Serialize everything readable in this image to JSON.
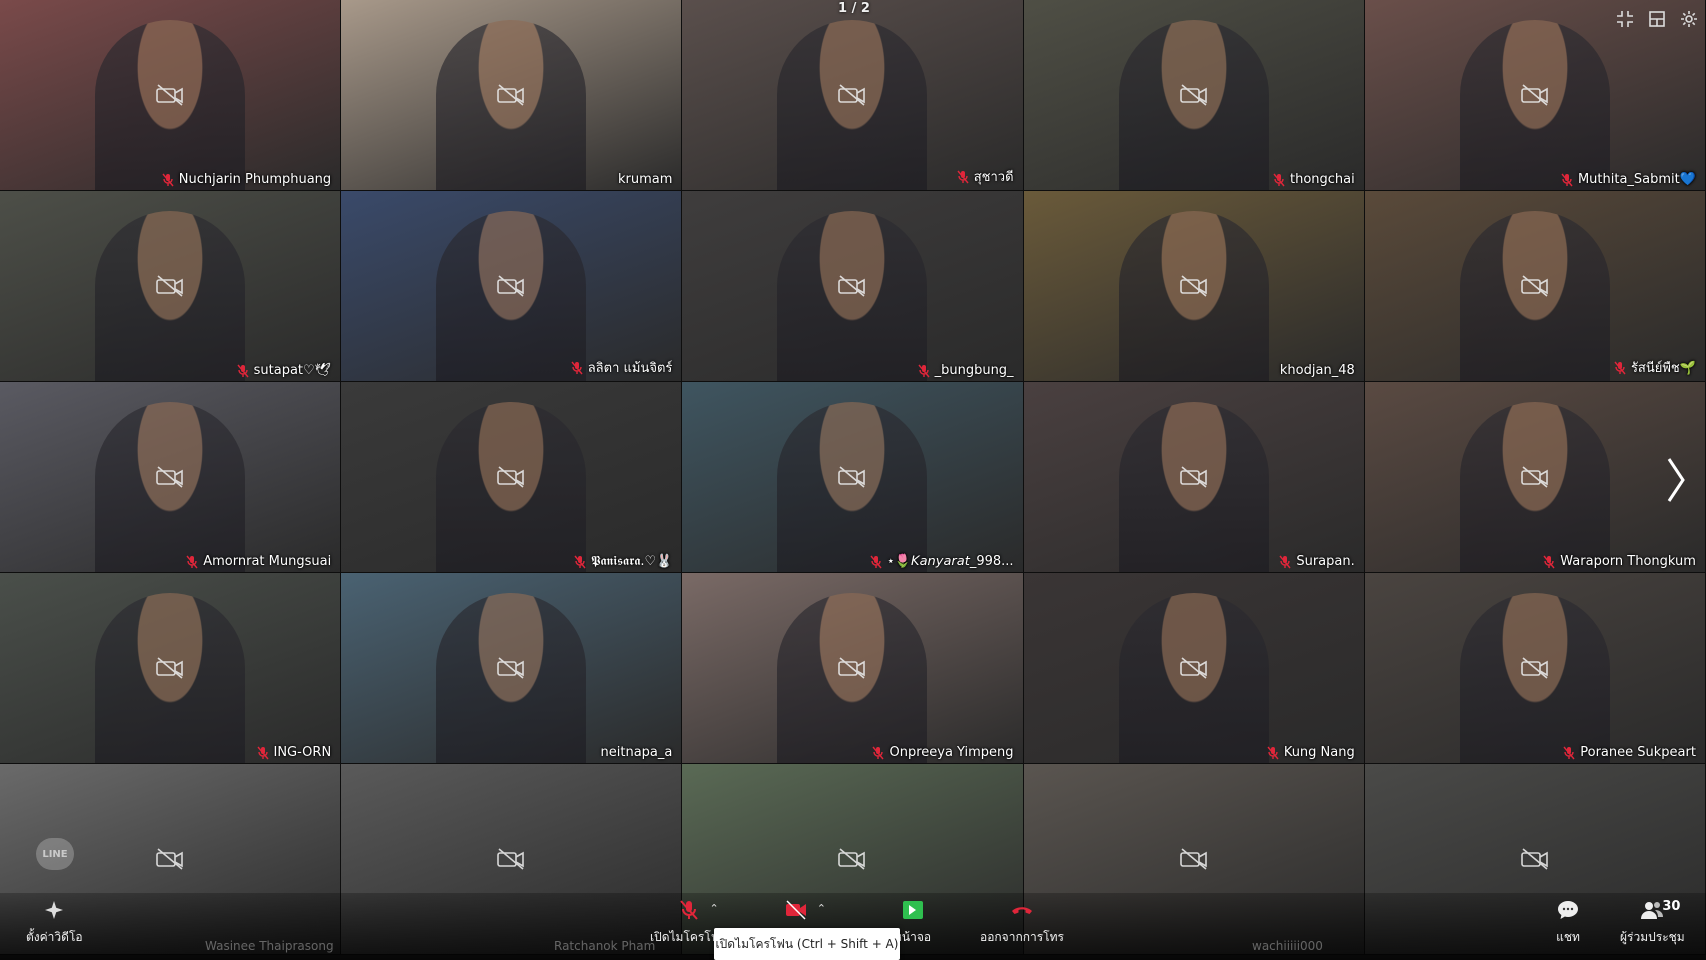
{
  "page_indicator": "1 / 2",
  "participants": [
    {
      "name": "Nuchjarin Phumphuang",
      "muted": true,
      "bg": "#7a4a4a"
    },
    {
      "name": "krumam",
      "muted": false,
      "bg": "#a8998a"
    },
    {
      "name": "สุชาวดี",
      "muted": true,
      "bg": "#5a4f4c"
    },
    {
      "name": "thongchai",
      "muted": true,
      "bg": "#4f4f45"
    },
    {
      "name": "Muthita_Sabmit💙",
      "muted": true,
      "bg": "#6a4f4a"
    },
    {
      "name": "sutapat♡🕊",
      "muted": true,
      "bg": "#4d4f48"
    },
    {
      "name": "ลลิตา แม้นจิตร์",
      "muted": true,
      "bg": "#3a4a6a"
    },
    {
      "name": "_bungbung_",
      "muted": true,
      "bg": "#3f3d3d"
    },
    {
      "name": "khodjan_48",
      "muted": false,
      "bg": "#6a5a3a"
    },
    {
      "name": "รัสนีย์พืช🌱",
      "muted": true,
      "bg": "#5a4a3a"
    },
    {
      "name": "Amornrat  Mungsuai",
      "muted": true,
      "bg": "#5a5a62"
    },
    {
      "name": "𝕻𝖆𝖓𝖎𝖘𝖆𝖗𝖆.♡🐰",
      "muted": true,
      "bg": "#3a3a3a"
    },
    {
      "name": "⋆🌷𝘒𝘢𝘯𝘺𝘢𝘳𝘢𝘵_998...",
      "muted": true,
      "bg": "#3f5560"
    },
    {
      "name": "Surapan.",
      "muted": true,
      "bg": "#4a4040"
    },
    {
      "name": "Waraporn Thongkum",
      "muted": true,
      "bg": "#5a4a42"
    },
    {
      "name": "ING-ORN",
      "muted": true,
      "bg": "#4a4f4a"
    },
    {
      "name": "neitnapa_a",
      "muted": false,
      "bg": "#4a6272"
    },
    {
      "name": "Onpreeya Yimpeng",
      "muted": true,
      "bg": "#7a6a66"
    },
    {
      "name": "Kung Nang",
      "muted": true,
      "bg": "#3a3535"
    },
    {
      "name": "Poranee Sukpeart",
      "muted": true,
      "bg": "#4a4440"
    },
    {
      "name": "",
      "muted": false,
      "bg": "#6a6a6a"
    },
    {
      "name": "",
      "muted": false,
      "bg": "#5a5a5a"
    },
    {
      "name": "",
      "muted": false,
      "bg": "#5a6a55"
    },
    {
      "name": "",
      "muted": false,
      "bg": "#5a5550"
    },
    {
      "name": "",
      "muted": false,
      "bg": "#4a4a48"
    }
  ],
  "toolbar": {
    "effects_label": "ตั้งค่าวิดีโอ",
    "mic_label": "เปิดไมโครโฟน",
    "share_label": "หน้าจอ",
    "leave_label": "ออกจากการโทร",
    "chat_label": "แชท",
    "participants_label": "ผู้ร่วมประชุม",
    "participants_count": "30"
  },
  "tooltip": "เปิดไมโครโฟน (Ctrl + Shift + A)",
  "ghost_names": [
    "Wasinee Thaiprasong",
    "Ratchanok Pham",
    "wachiiiii000"
  ],
  "line_logo": "LINE",
  "colors": {
    "mic_muted": "#e0263a",
    "share": "#2fbf4f",
    "leave": "#e0263a"
  }
}
